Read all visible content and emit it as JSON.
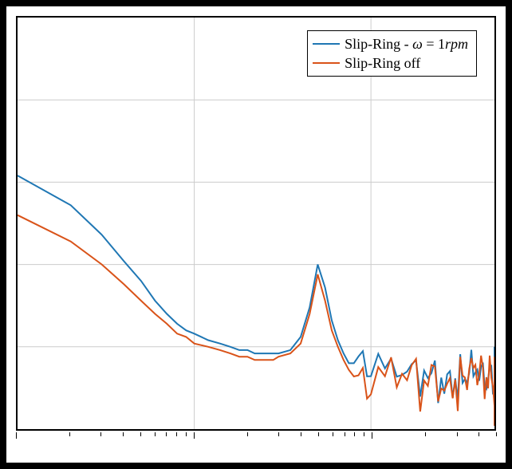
{
  "chart_data": {
    "type": "line",
    "xscale": "log",
    "xlim": [
      1,
      500
    ],
    "ylim": [
      -25,
      100
    ],
    "xlabel": "",
    "ylabel": "",
    "title": "",
    "grid": true,
    "legend_position": "upper-right",
    "series": [
      {
        "name": "Slip-Ring - ω = 1rpm",
        "color": "#1f77b4",
        "x": [
          1,
          2,
          3,
          4,
          5,
          6,
          7,
          8,
          9,
          10,
          12,
          14,
          16,
          18,
          20,
          22,
          24,
          26,
          28,
          30,
          35,
          40,
          45,
          50,
          55,
          60,
          65,
          70,
          75,
          80,
          85,
          90,
          95,
          100,
          110,
          120,
          130,
          140,
          150,
          160,
          170,
          180,
          190,
          200,
          210,
          220,
          230,
          240,
          250,
          260,
          270,
          280,
          290,
          300,
          310,
          320,
          330,
          340,
          350,
          360,
          370,
          380,
          390,
          400,
          410,
          420,
          430,
          440,
          450,
          460,
          470,
          480,
          490,
          500
        ],
        "y": [
          52,
          43,
          34,
          26,
          20,
          14,
          10,
          7,
          5,
          4,
          2,
          1,
          0,
          -1,
          -1,
          -2,
          -2,
          -2,
          -2,
          -2,
          -1,
          3,
          12,
          25,
          18,
          8,
          2,
          -2,
          -5,
          -5,
          -4,
          -5,
          -6,
          -7,
          -6,
          -9,
          -9,
          -8,
          -10,
          -9,
          -8,
          -10,
          -9,
          -7,
          -8,
          -10,
          -9,
          -11,
          -8,
          -10,
          -9,
          -7,
          -11,
          -8,
          -10,
          -7,
          -12,
          -8,
          -10,
          -9,
          -7,
          -11,
          -9,
          -8,
          -10,
          -12,
          -7,
          -9,
          -11,
          -8,
          -10,
          -7,
          -12,
          -8
        ]
      },
      {
        "name": "Slip-Ring off",
        "color": "#d95319",
        "x": [
          1,
          2,
          3,
          4,
          5,
          6,
          7,
          8,
          9,
          10,
          12,
          14,
          16,
          18,
          20,
          22,
          24,
          26,
          28,
          30,
          35,
          40,
          45,
          50,
          55,
          60,
          65,
          70,
          75,
          80,
          85,
          90,
          95,
          100,
          110,
          120,
          130,
          140,
          150,
          160,
          170,
          180,
          190,
          200,
          210,
          220,
          230,
          240,
          250,
          260,
          270,
          280,
          290,
          300,
          310,
          320,
          330,
          340,
          350,
          360,
          370,
          380,
          390,
          400,
          410,
          420,
          430,
          440,
          450,
          460,
          470,
          480,
          490,
          500
        ],
        "y": [
          40,
          32,
          25,
          19,
          14,
          10,
          7,
          4,
          3,
          1,
          0,
          -1,
          -2,
          -3,
          -3,
          -4,
          -4,
          -4,
          -4,
          -3,
          -2,
          1,
          10,
          22,
          14,
          5,
          0,
          -4,
          -7,
          -9,
          -10,
          -11,
          -12,
          -12,
          -11,
          -12,
          -10,
          -11,
          -10,
          -12,
          -9,
          -11,
          -12,
          -10,
          -10,
          -8,
          -12,
          -9,
          -11,
          -8,
          -12,
          -9,
          -10,
          -8,
          -12,
          -9,
          -10,
          -7,
          -12,
          -8,
          -11,
          -9,
          -7,
          -13,
          -8,
          -10,
          -9,
          -12,
          -7,
          -10,
          -8,
          -11,
          -9,
          -13
        ]
      }
    ],
    "legend": [
      {
        "label_html": "Slip-Ring - <i>ω</i> = 1<i>rpm</i>"
      },
      {
        "label_html": "Slip-Ring off"
      }
    ],
    "xgrid_at": [
      10,
      100
    ],
    "ygrid_count": 5
  }
}
